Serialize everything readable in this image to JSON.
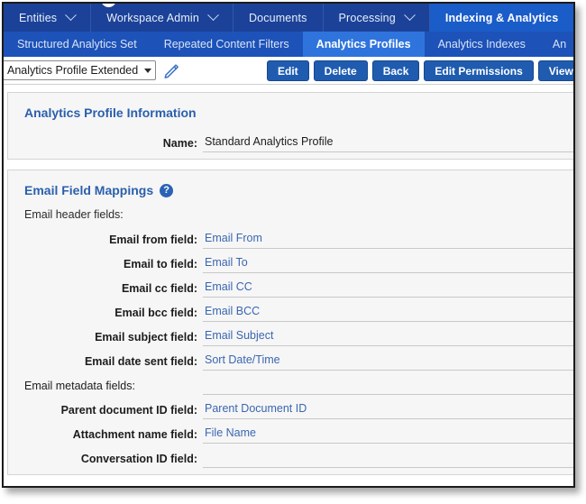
{
  "nav": {
    "items": [
      {
        "label": "Entities",
        "has_caret": true,
        "active": false
      },
      {
        "label": "Workspace Admin",
        "has_caret": true,
        "active": false
      },
      {
        "label": "Documents",
        "has_caret": false,
        "active": false
      },
      {
        "label": "Processing",
        "has_caret": true,
        "active": false
      },
      {
        "label": "Indexing & Analytics",
        "has_caret": false,
        "active": true
      }
    ]
  },
  "subnav": {
    "items": [
      {
        "label": "Structured Analytics Set",
        "active": false
      },
      {
        "label": "Repeated Content Filters",
        "active": false
      },
      {
        "label": "Analytics Profiles",
        "active": true
      },
      {
        "label": "Analytics Indexes",
        "active": false
      },
      {
        "label": "An",
        "active": false
      }
    ]
  },
  "toolbar": {
    "profile_selector_value": "Analytics Profile Extended",
    "edit_label": "Edit",
    "delete_label": "Delete",
    "back_label": "Back",
    "edit_permissions_label": "Edit Permissions",
    "view_audit_label": "View Audit"
  },
  "profile_info": {
    "title": "Analytics Profile Information",
    "name_label": "Name:",
    "name_value": "Standard Analytics Profile"
  },
  "email_field_mappings": {
    "title": "Email Field Mappings",
    "help_glyph": "?",
    "header_group_label": "Email header fields:",
    "metadata_group_label": "Email metadata fields:",
    "header_fields": [
      {
        "label": "Email from field:",
        "value": "Email From"
      },
      {
        "label": "Email to field:",
        "value": "Email To"
      },
      {
        "label": "Email cc field:",
        "value": "Email CC"
      },
      {
        "label": "Email bcc field:",
        "value": "Email BCC"
      },
      {
        "label": "Email subject field:",
        "value": "Email Subject"
      },
      {
        "label": "Email date sent field:",
        "value": "Sort Date/Time"
      }
    ],
    "metadata_fields": [
      {
        "label": "Parent document ID field:",
        "value": "Parent Document ID"
      },
      {
        "label": "Attachment name field:",
        "value": "File Name"
      },
      {
        "label": "Conversation ID field:",
        "value": ""
      }
    ]
  },
  "colors": {
    "nav_bg": "#1b4298",
    "nav_active_bg": "#1a5cc8",
    "subnav_bg": "#1d52b8",
    "subnav_active_bg": "#2f74dd",
    "button_bg": "#1f5cb0",
    "panel_title": "#2a5fad",
    "field_value": "#3a66b0",
    "panel_bg": "#f6f6f6"
  }
}
